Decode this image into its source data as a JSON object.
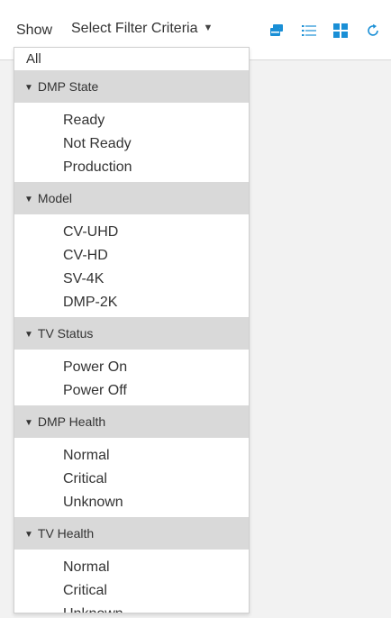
{
  "toolbar": {
    "show_label": "Show",
    "filter_select_label": "Select Filter Criteria"
  },
  "icons": {
    "tile_view": "overlapping-windows-icon",
    "list_view": "list-icon",
    "grid_view": "grid-icon",
    "refresh": "refresh-icon"
  },
  "colors": {
    "accent": "#1a8fd6",
    "group_header_bg": "#d9d9d9",
    "text": "#333333"
  },
  "dropdown": {
    "all_label": "All",
    "groups": [
      {
        "label": "DMP State",
        "items": [
          "Ready",
          "Not Ready",
          "Production"
        ]
      },
      {
        "label": "Model",
        "items": [
          "CV-UHD",
          "CV-HD",
          "SV-4K",
          "DMP-2K"
        ]
      },
      {
        "label": "TV Status",
        "items": [
          "Power On",
          "Power Off"
        ]
      },
      {
        "label": "DMP Health",
        "items": [
          "Normal",
          "Critical",
          "Unknown"
        ]
      },
      {
        "label": "TV Health",
        "items": [
          "Normal",
          "Critical",
          "Unknown"
        ]
      }
    ]
  }
}
